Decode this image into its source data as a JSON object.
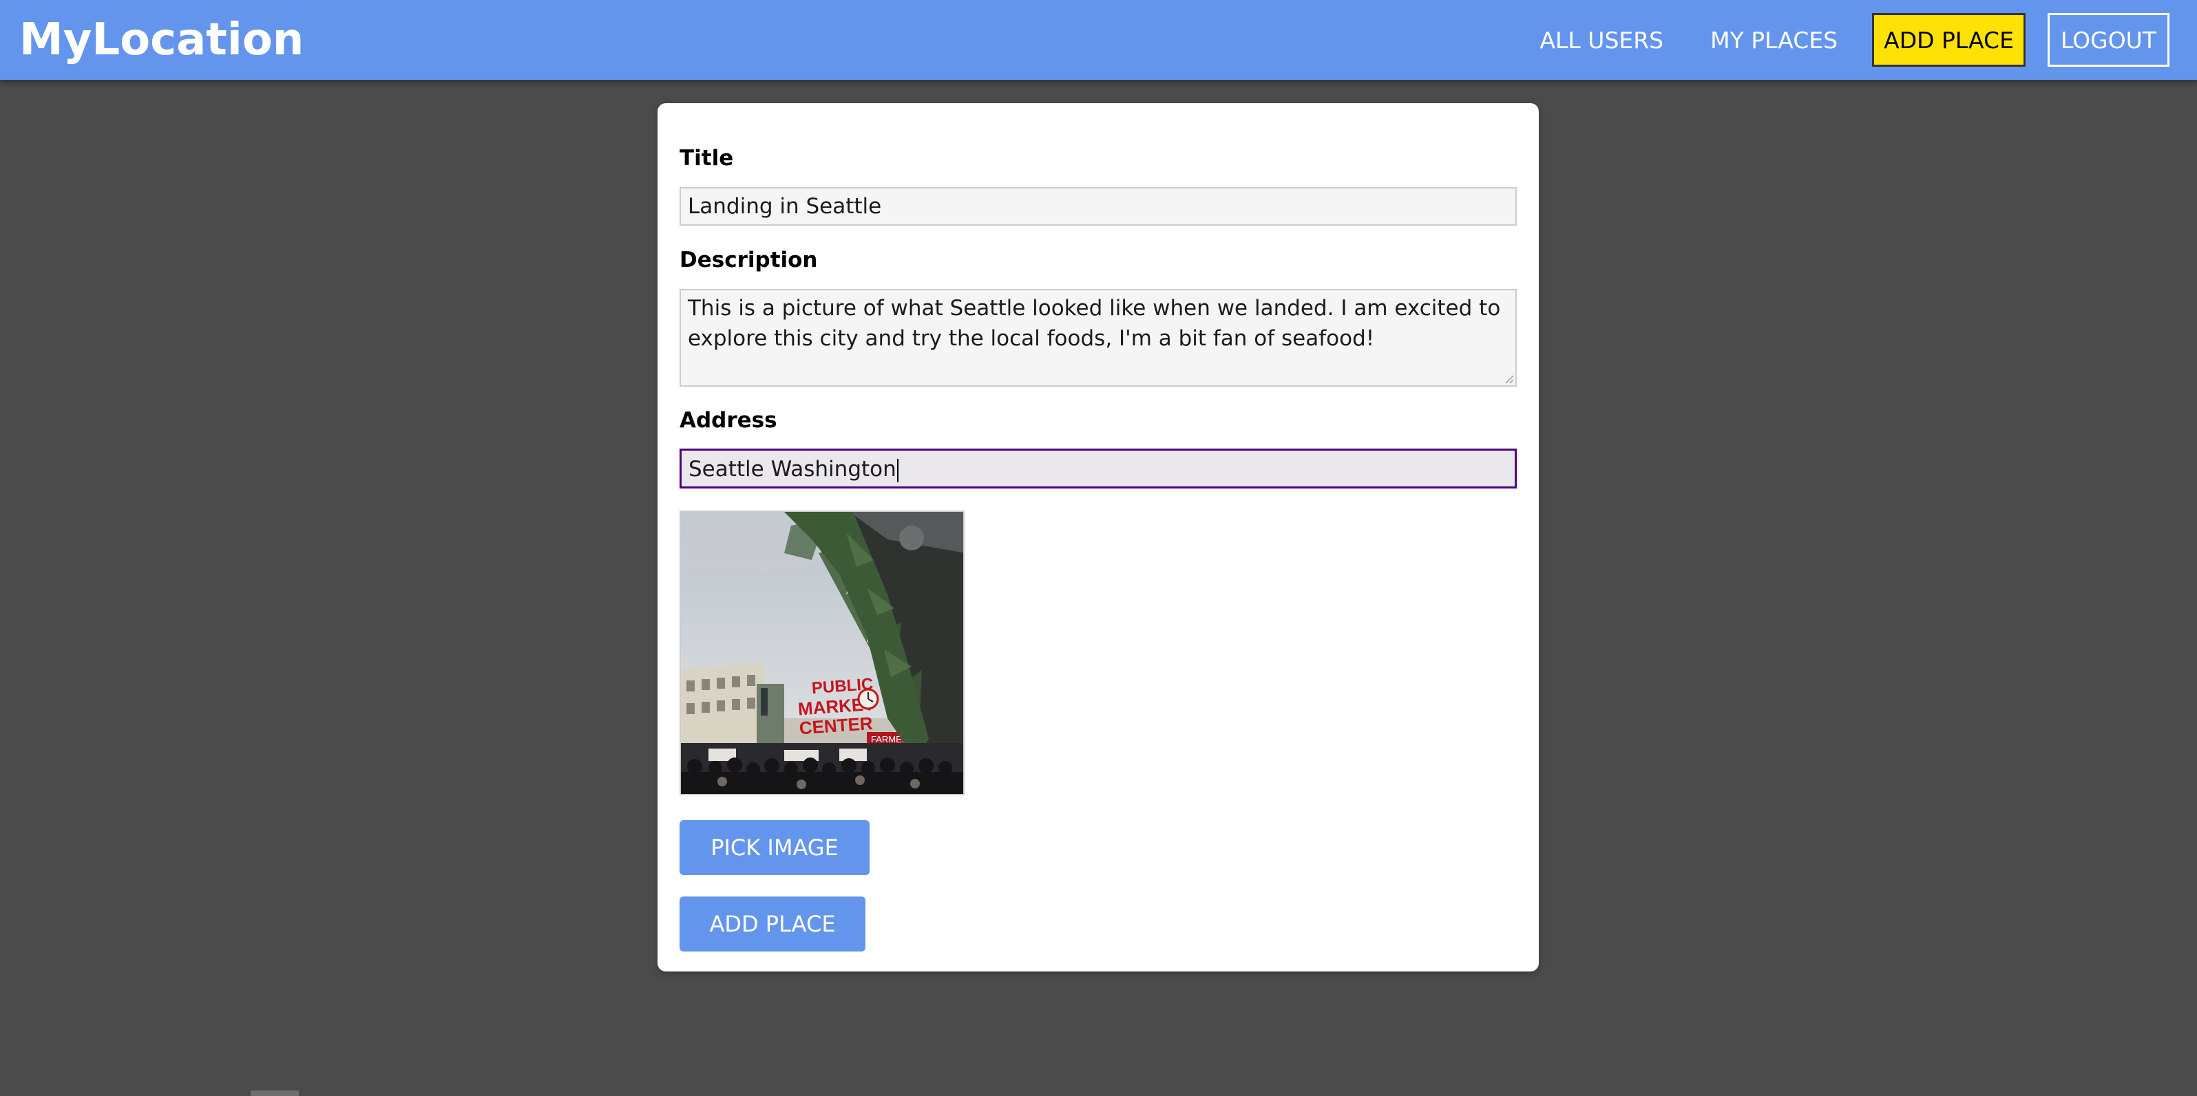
{
  "header": {
    "brand": "MyLocation",
    "nav": {
      "all_users": "ALL USERS",
      "my_places": "MY PLACES",
      "add_place": "ADD PLACE",
      "logout": "LOGOUT"
    }
  },
  "form": {
    "title_label": "Title",
    "title_value": "Landing in Seattle",
    "description_label": "Description",
    "description_value": "This is a picture of what Seattle looked like when we landed. I am excited to explore this city and try the local foods, I'm a bit fan of seafood!",
    "address_label": "Address",
    "address_value": "Seattle Washington",
    "image_sign": {
      "line1": "PUBLIC",
      "line2": "MARKET",
      "line3": "CENTER",
      "small": "FARMERS M"
    },
    "pick_image_label": "PICK IMAGE",
    "submit_label": "ADD PLACE"
  },
  "colors": {
    "header_bg": "#6495ed",
    "page_bg": "#4b4b4b",
    "active_nav_bg": "#ffe205",
    "button_bg": "#6495ed",
    "focus_border": "#510077"
  }
}
